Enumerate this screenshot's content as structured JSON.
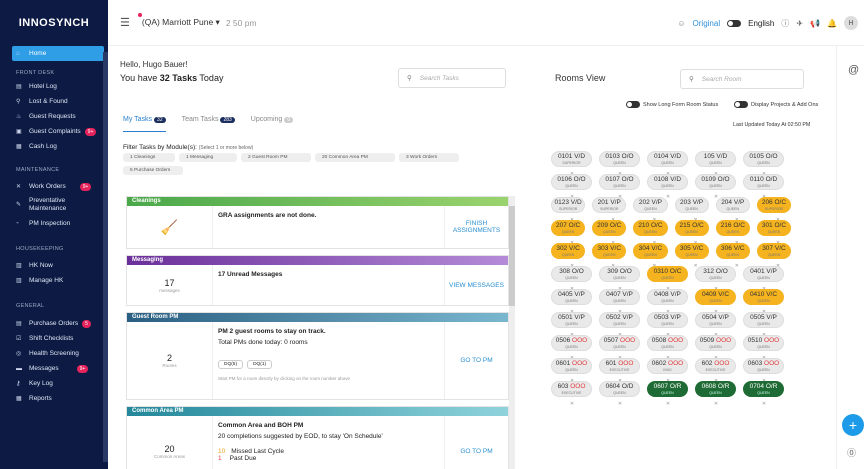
{
  "sidebar": {
    "logo": "INNOSYNCH",
    "home": "Home",
    "sect_front": "FRONT DESK",
    "hotel_log": "Hotel Log",
    "lost_found": "Lost & Found",
    "guest_requests": "Guest Requests",
    "guest_complaints": "Guest Complaints",
    "guest_complaints_badge": "9+",
    "cash_log": "Cash Log",
    "sect_maint": "MAINTENANCE",
    "work_orders": "Work Orders",
    "work_orders_badge": "9+",
    "preventive": "Preventative Maintenance",
    "pm_inspection": "PM Inspection",
    "sect_hk": "HOUSEKEEPING",
    "hk_now": "HK Now",
    "manage_hk": "Manage HK",
    "sect_general": "GENERAL",
    "purchase_orders": "Purchase Orders",
    "purchase_orders_badge": "5",
    "shift_checklists": "Shift Checklists",
    "health_screening": "Health Screening",
    "messages": "Messages",
    "messages_badge": "9+",
    "key_log": "Key Log",
    "reports": "Reports"
  },
  "topbar": {
    "hotel": "(QA) Marriott Pune ▾",
    "time": "2 50 pm",
    "original": "Original",
    "english": "English",
    "avatar": "H"
  },
  "tasks": {
    "hello": "Hello, Hugo Bauer!",
    "today_pre": "You have ",
    "today_count": "32 Tasks",
    "today_post": " Today",
    "search_placeholder": "Search Tasks",
    "tabs": [
      {
        "label": "My Tasks",
        "count": "32"
      },
      {
        "label": "Team Tasks",
        "count": "283"
      },
      {
        "label": "Upcoming",
        "count": "0"
      }
    ],
    "filter_label": "Filter Tasks by Module(s):",
    "filter_hint": "(Select 1 or more below)",
    "chips": [
      "1 Cleanings",
      "1 Messaging",
      "2 Guest Room PM",
      "20 Common Area PM",
      "3 Work Orders",
      "5 Purchase Orders"
    ],
    "cards": [
      {
        "header": "Cleanings",
        "color": "#5cb85c",
        "left_num": "",
        "left_label": "",
        "title": "GRA assignments are not done.",
        "line2": "",
        "action": "FINISH ASSIGNMENTS"
      },
      {
        "header": "Messaging",
        "color": "#7b3fa6",
        "left_num": "17",
        "left_label": "messages",
        "title": "17 Unread Messages",
        "line2": "",
        "action": "VIEW MESSAGES"
      },
      {
        "header": "Guest Room PM",
        "color": "#2a6f8f",
        "left_num": "2",
        "left_label": "Rooms",
        "title": "PM 2 guest rooms to stay on track.",
        "line2": "Total PMs done today: 0 rooms",
        "action": "GO TO PM",
        "pills": [
          "DQ(5)",
          "DQ(1)"
        ],
        "hint": "Start PM for a room directly by clicking on the room number above"
      },
      {
        "header": "Common Area PM",
        "color": "#2a8fa0",
        "left_num": "20",
        "left_label": "Common Areas",
        "title": "Common Area and BOH PM",
        "line2": "20 completions suggested by EOD, to stay 'On Schedule'",
        "action": "GO TO PM",
        "missed_n": "10",
        "missed": "Missed Last Cycle",
        "past_n": "1",
        "past": "Past Due"
      }
    ]
  },
  "rooms": {
    "title": "Rooms View",
    "search_placeholder": "Search Room",
    "opt1": "Show Long Form Room Status",
    "opt2": "Display Projects & Add Ons",
    "updated": "Last Updated Today At 02:50 PM",
    "rows": [
      [
        {
          "n": "0101",
          "s": "V/D",
          "t": "SUPERIOR",
          "c": "n"
        },
        {
          "n": "0103",
          "s": "O/O",
          "t": "QUEEN",
          "c": "n"
        },
        {
          "n": "0104",
          "s": "V/D",
          "t": "QUEEN",
          "c": "n"
        },
        {
          "n": "105",
          "s": "V/D",
          "t": "QUEEN",
          "c": "n"
        },
        {
          "n": "0105",
          "s": "O/O",
          "t": "QUEEN",
          "c": "n"
        }
      ],
      [
        {
          "n": "0106",
          "s": "O/O",
          "t": "QUEEN",
          "c": "n"
        },
        {
          "n": "0107",
          "s": "O/O",
          "t": "QUEEN",
          "c": "n"
        },
        {
          "n": "0108",
          "s": "V/D",
          "t": "QUEEN",
          "c": "n"
        },
        {
          "n": "0109",
          "s": "O/O",
          "t": "QUEEN",
          "c": "n"
        },
        {
          "n": "0110",
          "s": "O/D",
          "t": "QUEEN",
          "c": "n"
        }
      ],
      [
        {
          "n": "0123",
          "s": "V/D",
          "t": "SUPERIOR",
          "c": "n"
        },
        {
          "n": "201",
          "s": "V/P",
          "t": "SUPERIOR",
          "c": "n"
        },
        {
          "n": "202",
          "s": "V/P",
          "t": "QUEEN",
          "c": "n"
        },
        {
          "n": "203",
          "s": "V/P",
          "t": "QUEEN",
          "c": "n"
        },
        {
          "n": "204",
          "s": "V/P",
          "t": "QUEEN",
          "c": "n"
        },
        {
          "n": "206",
          "s": "O/C",
          "t": "SUPERIOR",
          "c": "y"
        }
      ],
      [
        {
          "n": "207",
          "s": "O/C",
          "t": "QUEEN",
          "c": "y"
        },
        {
          "n": "209",
          "s": "O/C",
          "t": "QUEEN",
          "c": "y"
        },
        {
          "n": "210",
          "s": "O/C",
          "t": "QUEEN",
          "c": "y"
        },
        {
          "n": "215",
          "s": "O/C",
          "t": "QUEEN",
          "c": "y"
        },
        {
          "n": "216",
          "s": "O/C",
          "t": "QUEEN",
          "c": "y"
        },
        {
          "n": "301",
          "s": "O/C",
          "t": "QUEEN",
          "c": "y"
        }
      ],
      [
        {
          "n": "302",
          "s": "V/C",
          "t": "QUEEN",
          "c": "y"
        },
        {
          "n": "303",
          "s": "V/C",
          "t": "QUEEN",
          "c": "y"
        },
        {
          "n": "304",
          "s": "V/C",
          "t": "QUEEN",
          "c": "y"
        },
        {
          "n": "305",
          "s": "V/C",
          "t": "QUEEN",
          "c": "y"
        },
        {
          "n": "306",
          "s": "V/C",
          "t": "QUEEN",
          "c": "y"
        },
        {
          "n": "307",
          "s": "V/C",
          "t": "QUEEN",
          "c": "y"
        }
      ],
      [
        {
          "n": "308",
          "s": "O/O",
          "t": "QUEEN",
          "c": "n"
        },
        {
          "n": "309",
          "s": "O/O",
          "t": "QUEEN",
          "c": "n"
        },
        {
          "n": "0310",
          "s": "O/C",
          "t": "QUEEN",
          "c": "y"
        },
        {
          "n": "312",
          "s": "O/O",
          "t": "QUEEN",
          "c": "n"
        },
        {
          "n": "0401",
          "s": "V/P",
          "t": "QUEEN",
          "c": "n"
        }
      ],
      [
        {
          "n": "0405",
          "s": "V/P",
          "t": "QUEEN",
          "c": "n"
        },
        {
          "n": "0407",
          "s": "V/P",
          "t": "QUEEN",
          "c": "n"
        },
        {
          "n": "0408",
          "s": "V/P",
          "t": "QUEEN",
          "c": "n"
        },
        {
          "n": "0409",
          "s": "V/C",
          "t": "QUEEN",
          "c": "y"
        },
        {
          "n": "0410",
          "s": "V/C",
          "t": "QUEEN",
          "c": "y"
        }
      ],
      [
        {
          "n": "0501",
          "s": "V/P",
          "t": "QUEEN",
          "c": "n"
        },
        {
          "n": "0502",
          "s": "V/P",
          "t": "QUEEN",
          "c": "n"
        },
        {
          "n": "0503",
          "s": "V/P",
          "t": "QUEEN",
          "c": "n"
        },
        {
          "n": "0504",
          "s": "V/P",
          "t": "QUEEN",
          "c": "n"
        },
        {
          "n": "0505",
          "s": "V/P",
          "t": "QUEEN",
          "c": "n"
        }
      ],
      [
        {
          "n": "0506",
          "s": "OOO",
          "t": "QUEEN",
          "c": "r"
        },
        {
          "n": "0507",
          "s": "OOO",
          "t": "QUEEN",
          "c": "r"
        },
        {
          "n": "0508",
          "s": "OOO",
          "t": "QUEEN",
          "c": "r"
        },
        {
          "n": "0509",
          "s": "OOO",
          "t": "QUEEN",
          "c": "r"
        },
        {
          "n": "0510",
          "s": "OOO",
          "t": "QUEEN",
          "c": "r"
        }
      ],
      [
        {
          "n": "0601",
          "s": "OOO",
          "t": "QUEEN",
          "c": "r"
        },
        {
          "n": "601",
          "s": "OOO",
          "t": "EXECUTIVE",
          "c": "r"
        },
        {
          "n": "0602",
          "s": "OOO",
          "t": "KING",
          "c": "r"
        },
        {
          "n": "602",
          "s": "OOO",
          "t": "EXECUTIVE",
          "c": "r"
        },
        {
          "n": "0603",
          "s": "OOO",
          "t": "QUEEN",
          "c": "r"
        }
      ],
      [
        {
          "n": "603",
          "s": "OOO",
          "t": "EXECUTIVE",
          "c": "r"
        },
        {
          "n": "0604",
          "s": "O/D",
          "t": "QUEEN",
          "c": "n"
        },
        {
          "n": "0607",
          "s": "O/R",
          "t": "QUEEN",
          "c": "g"
        },
        {
          "n": "0608",
          "s": "O/R",
          "t": "QUEEN",
          "c": "g"
        },
        {
          "n": "0704",
          "s": "O/R",
          "t": "QUEEN",
          "c": "g"
        }
      ]
    ]
  }
}
